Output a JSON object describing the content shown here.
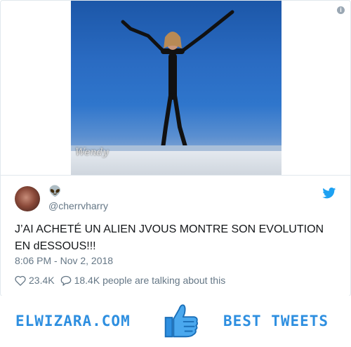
{
  "tweet": {
    "handle": "@cherrvharry",
    "text": "J’AI ACHETÉ UN ALIEN JVOUS MONTRE SON EVOLUTION EN dESSOUS!!!",
    "timestamp": "8:06 PM - Nov 2, 2018",
    "likes": "23.4K",
    "talking": "18.4K people are talking about this",
    "media_watermark": "Wendy",
    "info_glyph": "i",
    "name_emoji": "👽"
  },
  "footer": {
    "site": "ELWIZARA.COM",
    "label": "BEST TWEETS"
  },
  "colors": {
    "twitter_blue": "#1da1f2",
    "footer_blue": "#2e8fe0",
    "muted": "#657786"
  },
  "icons": [
    "info-icon",
    "twitter-bird-icon",
    "heart-icon",
    "comment-icon",
    "thumbs-up-icon"
  ]
}
